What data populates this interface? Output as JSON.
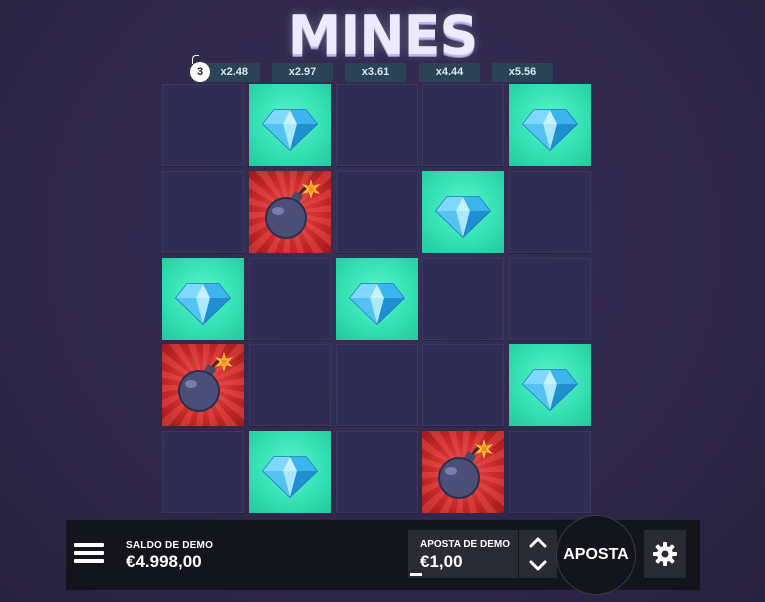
{
  "title": "MINES",
  "mine_count": "3",
  "multipliers": [
    "x2.48",
    "x2.97",
    "x3.61",
    "x4.44",
    "x5.56"
  ],
  "grid": [
    [
      "hidden",
      "gem",
      "hidden",
      "hidden",
      "gem"
    ],
    [
      "hidden",
      "bomb",
      "hidden",
      "gem",
      "hidden"
    ],
    [
      "gem",
      "hidden",
      "gem",
      "hidden",
      "hidden"
    ],
    [
      "bomb",
      "hidden",
      "hidden",
      "hidden",
      "gem"
    ],
    [
      "hidden",
      "gem",
      "hidden",
      "bomb",
      "hidden"
    ]
  ],
  "bottom_bar": {
    "balance_label": "SALDO DE DEMO",
    "balance_value": "€4.998,00",
    "bet_label": "APOSTA DE DEMO",
    "bet_value": "€1,00",
    "bet_button": "APOSTA"
  },
  "icons": {
    "menu": "menu-icon",
    "up": "chevron-up-icon",
    "down": "chevron-down-icon",
    "settings": "gear-icon",
    "gem": "diamond-icon",
    "bomb": "bomb-icon"
  },
  "colors": {
    "background": "#2e2749",
    "gem_tile": "#35e1b5",
    "bomb_tile": "#c42828",
    "hidden_tile": "#2f2d53",
    "multiplier_bg": "#2b4357",
    "bar_bg": "#14141c"
  }
}
